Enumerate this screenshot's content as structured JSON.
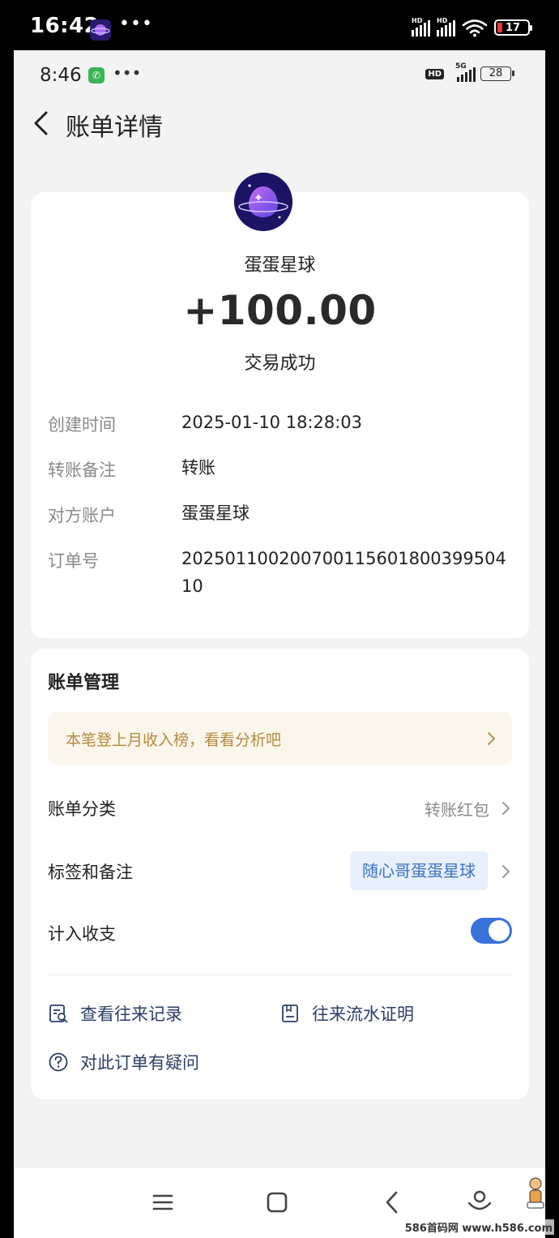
{
  "system_status": {
    "time": "16:42",
    "dots": "•••",
    "battery": "17",
    "signal_label": "HD"
  },
  "inner_status": {
    "time": "8:46",
    "dots": "•••",
    "battery": "28",
    "hd_label": "HD",
    "network": "5G"
  },
  "header": {
    "title": "账单详情"
  },
  "transaction": {
    "merchant": "蛋蛋星球",
    "amount": "+100.00",
    "status": "交易成功",
    "details": [
      {
        "label": "创建时间",
        "value": "2025-01-10 18:28:03"
      },
      {
        "label": "转账备注",
        "value": "转账"
      },
      {
        "label": "对方账户",
        "value": "蛋蛋星球"
      },
      {
        "label": "订单号",
        "value": "20250110020070011560180039950410"
      }
    ]
  },
  "management": {
    "title": "账单管理",
    "promo": "本笔登上月收入榜，看看分析吧",
    "category_label": "账单分类",
    "category_value": "转账红包",
    "tags_label": "标签和备注",
    "tags_value": "随心哥蛋蛋星球",
    "include_label": "计入收支",
    "include_enabled": true,
    "link_records": "查看往来记录",
    "link_proof": "往来流水证明",
    "link_question": "对此订单有疑问"
  },
  "colors": {
    "accent": "#3a72dc",
    "promo_text": "#b48a3e",
    "tag_text": "#3b72c6",
    "link_text": "#2c3e66"
  },
  "icons": [
    "back-chevron-icon",
    "search-record-icon",
    "document-proof-icon",
    "question-icon",
    "menu-icon",
    "home-icon",
    "back-icon",
    "assistant-icon"
  ],
  "watermark": "586首码网 www.h586.com"
}
